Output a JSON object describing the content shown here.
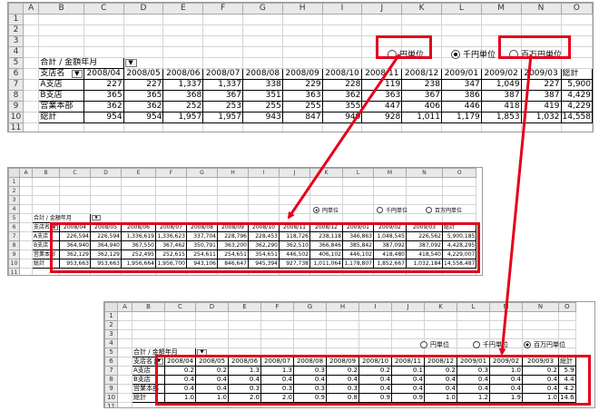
{
  "col_letters": [
    "A",
    "B",
    "C",
    "D",
    "E",
    "F",
    "G",
    "H",
    "I",
    "J",
    "K",
    "L",
    "M",
    "N",
    "O"
  ],
  "row_numbers": [
    "1",
    "2",
    "3",
    "4",
    "5",
    "6",
    "7",
    "8",
    "9",
    "10",
    "11"
  ],
  "pivot_title": "合計 / 金額",
  "pivot_field_year": "年月",
  "dropdown_glyph": "▼",
  "branch_header": "支店名",
  "months": [
    "2008/04",
    "2008/05",
    "2008/06",
    "2008/07",
    "2008/08",
    "2008/09",
    "2008/10",
    "2008/11",
    "2008/12",
    "2009/01",
    "2009/02",
    "2009/03"
  ],
  "total_label": "総計",
  "row_labels": [
    "A支店",
    "B支店",
    "営業本部",
    "総計"
  ],
  "radio_labels": {
    "yen": "円単位",
    "thousand": "千円単位",
    "million": "百万円単位"
  },
  "sheet1": {
    "selected": "thousand",
    "rows": [
      [
        "227",
        "227",
        "1,337",
        "1,337",
        "338",
        "229",
        "228",
        "119",
        "238",
        "347",
        "1,049",
        "227",
        "5,900"
      ],
      [
        "365",
        "365",
        "368",
        "367",
        "351",
        "363",
        "362",
        "363",
        "367",
        "386",
        "387",
        "387",
        "4,429"
      ],
      [
        "362",
        "362",
        "252",
        "253",
        "255",
        "255",
        "355",
        "447",
        "406",
        "446",
        "418",
        "419",
        "4,229"
      ],
      [
        "954",
        "954",
        "1,957",
        "1,957",
        "943",
        "847",
        "949",
        "928",
        "1,011",
        "1,179",
        "1,853",
        "1,032",
        "14,558"
      ]
    ]
  },
  "sheet2": {
    "selected": "yen",
    "rows": [
      [
        "226,594",
        "226,594",
        "1,336,619",
        "1,336,623",
        "337,704",
        "228,796",
        "228,453",
        "118,726",
        "238,118",
        "346,863",
        "1,048,545",
        "226,562",
        "5,900,185"
      ],
      [
        "364,940",
        "364,940",
        "367,550",
        "367,462",
        "350,791",
        "363,200",
        "362,290",
        "362,510",
        "366,846",
        "385,842",
        "387,092",
        "387,092",
        "4,428,295"
      ],
      [
        "362,129",
        "362,129",
        "252,495",
        "252,615",
        "254,611",
        "254,651",
        "354,651",
        "446,502",
        "406,102",
        "446,102",
        "418,480",
        "418,540",
        "4,229,007"
      ],
      [
        "953,663",
        "953,663",
        "1,956,664",
        "1,956,700",
        "943,106",
        "846,647",
        "945,394",
        "927,738",
        "1,011,064",
        "1,178,807",
        "1,852,667",
        "1,032,184",
        "14,558,487"
      ]
    ]
  },
  "sheet3": {
    "selected": "million",
    "rows": [
      [
        "0.2",
        "0.2",
        "1.3",
        "1.3",
        "0.3",
        "0.2",
        "0.2",
        "0.1",
        "0.2",
        "0.3",
        "1.0",
        "0.2",
        "5.9"
      ],
      [
        "0.4",
        "0.4",
        "0.4",
        "0.4",
        "0.4",
        "0.4",
        "0.4",
        "0.4",
        "0.4",
        "0.4",
        "0.4",
        "0.4",
        "4.4"
      ],
      [
        "0.4",
        "0.4",
        "0.3",
        "0.3",
        "0.3",
        "0.3",
        "0.4",
        "0.4",
        "0.4",
        "0.4",
        "0.4",
        "0.4",
        "4.2"
      ],
      [
        "1.0",
        "1.0",
        "2.0",
        "2.0",
        "0.9",
        "0.8",
        "0.9",
        "0.9",
        "1.0",
        "1.2",
        "1.9",
        "1.0",
        "14.6"
      ]
    ]
  },
  "colors": {
    "highlight_box": "#e4001b",
    "arrow": "#e4001b",
    "header_bg": "#e9e9e9",
    "grid": "#d4d4d4"
  }
}
